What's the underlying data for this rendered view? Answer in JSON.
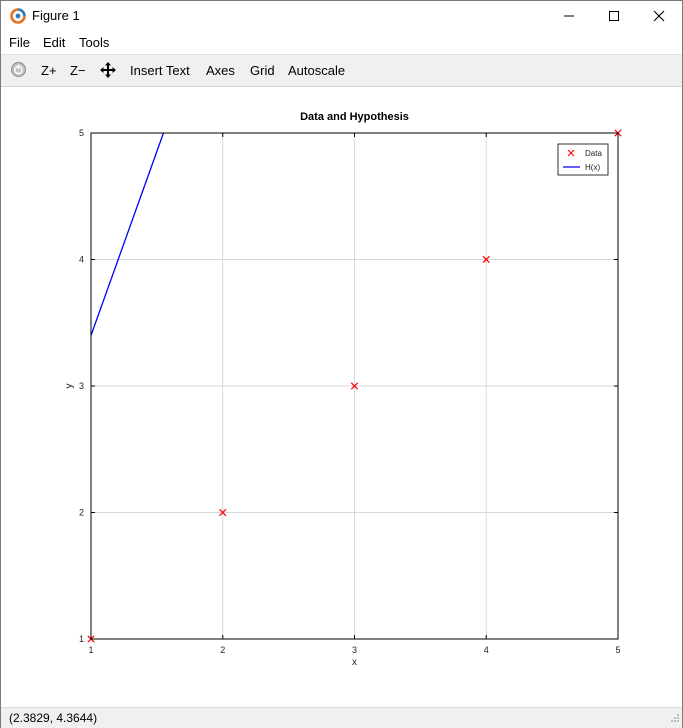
{
  "window": {
    "title": "Figure 1"
  },
  "menu": {
    "items": [
      "File",
      "Edit",
      "Tools"
    ]
  },
  "toolbar": {
    "zoom_in": "Z+",
    "zoom_out": "Z−",
    "insert_text": "Insert Text",
    "axes": "Axes",
    "grid": "Grid",
    "autoscale": "Autoscale"
  },
  "status": {
    "coords": "(2.3829, 4.3644)"
  },
  "colors": {
    "data": "#ff0000",
    "hypothesis": "#0000ff",
    "grid": "#d9d9d9",
    "toolbar_bg": "#f0f0f0"
  },
  "chart_data": {
    "type": "scatter",
    "title": "Data and Hypothesis",
    "xlabel": "x",
    "ylabel": "y",
    "xlim": [
      1,
      5
    ],
    "ylim": [
      1,
      5
    ],
    "xticks": [
      1,
      2,
      3,
      4,
      5
    ],
    "yticks": [
      1,
      2,
      3,
      4,
      5
    ],
    "grid": true,
    "legend_position": "top-right",
    "series": [
      {
        "name": "Data",
        "kind": "markers",
        "marker": "x",
        "color": "#ff0000",
        "x": [
          1,
          2,
          3,
          4,
          5
        ],
        "y": [
          1,
          2,
          3,
          4,
          5
        ]
      },
      {
        "name": "H(x)",
        "kind": "line",
        "color": "#0000ff",
        "x": [
          1,
          1.55
        ],
        "y": [
          3.4,
          5.0
        ]
      }
    ]
  }
}
